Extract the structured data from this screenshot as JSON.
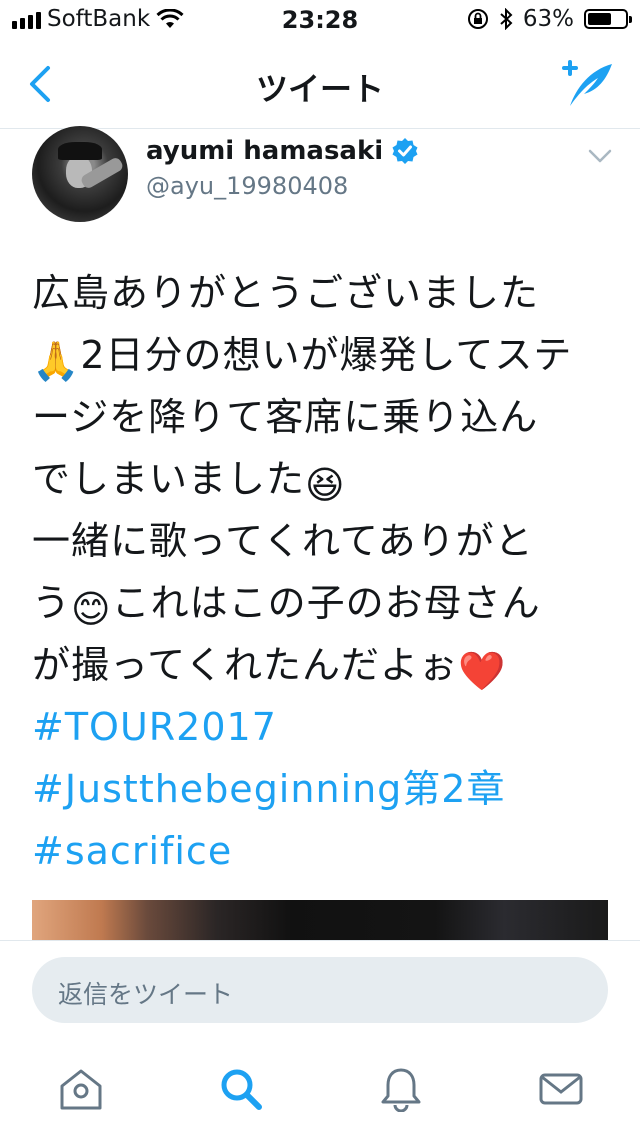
{
  "status_bar": {
    "carrier": "SoftBank",
    "time": "23:28",
    "battery_pct": "63%",
    "battery_level": 0.63
  },
  "nav": {
    "title": "ツイート"
  },
  "tweet": {
    "author_name": "ayumi hamasaki",
    "author_handle": "@ayu_19980408",
    "lines": [
      "広島ありがとうございました",
      "2日分の想いが爆発してステ",
      "ージを降りて客席に乗り込ん",
      "でしまいました",
      "一緒に歌ってくれてありがと",
      "う",
      "これはこの子のお母さん",
      "が撮ってくれたんだよぉ"
    ],
    "emojis": {
      "pray": "🙏",
      "laugh": "😆",
      "smile": "😊",
      "heart": "❤️"
    },
    "hashtags": [
      "#TOUR2017",
      "#Justthebeginning第2章",
      "#sacrifice"
    ]
  },
  "reply": {
    "placeholder": "返信をツイート"
  },
  "colors": {
    "accent": "#1da1f2",
    "text": "#14171a",
    "secondary": "#657786",
    "reply_bg": "#e6ecf0"
  },
  "tab_icons": [
    "home-icon",
    "search-icon",
    "notifications-icon",
    "messages-icon"
  ]
}
